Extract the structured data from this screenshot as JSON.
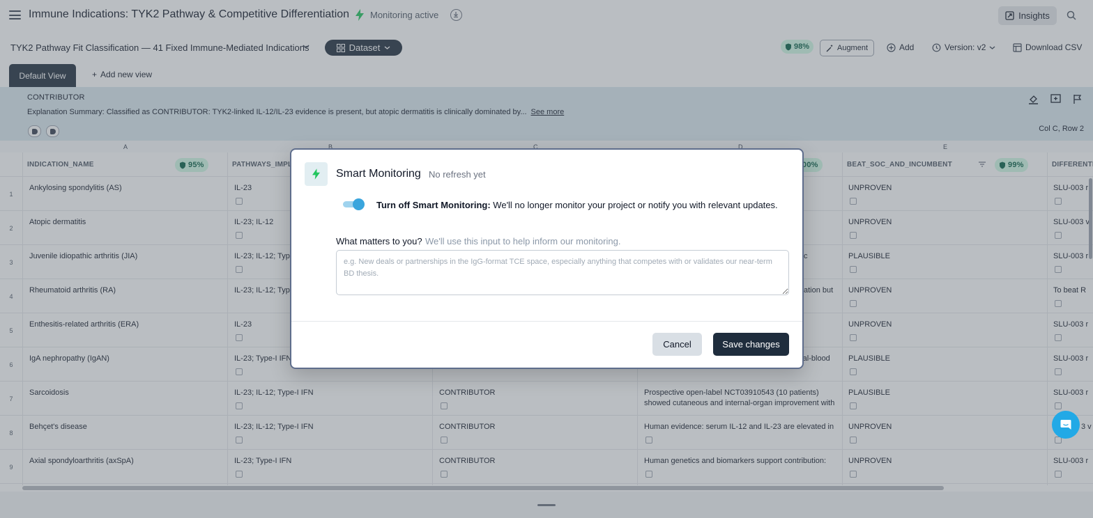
{
  "header": {
    "title": "Immune Indications: TYK2 Pathway & Competitive Differentiation",
    "monitoring_status": "Monitoring active",
    "insights_label": "Insights"
  },
  "toolbar": {
    "project_title": "TYK2 Pathway Fit Classification — 41 Fixed Immune-Mediated Indications",
    "dataset_label": "Dataset",
    "quality_badge": "98%",
    "augment_label": "Augment",
    "add_label": "Add",
    "version_label": "Version: v2",
    "download_label": "Download CSV"
  },
  "tabs": {
    "default_view": "Default View",
    "add_view": "Add new view"
  },
  "explanation": {
    "label": "CONTRIBUTOR",
    "text": "Explanation Summary: Classified as CONTRIBUTOR: TYK2-linked IL-12/IL-23 evidence is present, but atopic dermatitis is clinically dominated by...",
    "see_more": "See more",
    "cell_position": "Col C, Row 2"
  },
  "grid": {
    "column_letters": [
      "A",
      "B",
      "C",
      "D",
      "E"
    ],
    "headers": {
      "a": "INDICATION_NAME",
      "a_badge": "95%",
      "b": "PATHWAYS_IMPL",
      "d_badge": "00%",
      "e": "BEAT_SOC_AND_INCUMBENT",
      "e_badge": "99%",
      "f": "DIFFERENTIA"
    },
    "rows": [
      {
        "num": "1",
        "a": "Ankylosing spondylitis (AS)",
        "b": "IL-23",
        "c": "",
        "d": "",
        "e": "UNPROVEN",
        "f": "SLU-003 r"
      },
      {
        "num": "2",
        "a": "Atopic dermatitis",
        "b": "IL-23; IL-12",
        "c": "",
        "d": "",
        "e": "UNPROVEN",
        "f": "SLU-003 v"
      },
      {
        "num": "3",
        "a": "Juvenile idiopathic arthritis (JIA)",
        "b": "IL-23; IL-12; Typ",
        "c": "",
        "d": "c",
        "e": "PLAUSIBLE",
        "f": "SLU-003 r"
      },
      {
        "num": "4",
        "a": "Rheumatoid arthritis (RA)",
        "b": "IL-23; IL-12; Typ",
        "c": "",
        "d": "ation but",
        "e": "UNPROVEN",
        "f": "To beat R"
      },
      {
        "num": "5",
        "a": "Enthesitis-related arthritis (ERA)",
        "b": "IL-23",
        "c": "",
        "d": "",
        "e": "UNPROVEN",
        "f": "SLU-003 r"
      },
      {
        "num": "6",
        "a": "IgA nephropathy (IgAN)",
        "b": "IL-23; Type-I IFN",
        "c": "",
        "d": "ral-blood",
        "e": "PLAUSIBLE",
        "f": "SLU-003 r"
      },
      {
        "num": "7",
        "a": "Sarcoidosis",
        "b": "IL-23; IL-12; Type-I IFN",
        "c": "CONTRIBUTOR",
        "d": "Prospective open-label NCT03910543 (10 patients)",
        "d2": "showed cutaneous and internal-organ improvement with",
        "e": "PLAUSIBLE",
        "f": "SLU-003 r"
      },
      {
        "num": "8",
        "a": "Behçet's disease",
        "b": "IL-23; IL-12; Type-I IFN",
        "c": "CONTRIBUTOR",
        "d": "Human evidence: serum IL-12 and IL-23 are elevated in",
        "e": "UNPROVEN",
        "f": "3 v"
      },
      {
        "num": "9",
        "a": "Axial spondyloarthritis (axSpA)",
        "b": "IL-23; Type-I IFN",
        "c": "CONTRIBUTOR",
        "d": "Human genetics and biomarkers support contribution:",
        "e": "UNPROVEN",
        "f": "SLU-003 r"
      }
    ]
  },
  "modal": {
    "title": "Smart Monitoring",
    "subtitle": "No refresh yet",
    "toggle_bold": "Turn off Smart Monitoring:",
    "toggle_text": " We'll no longer monitor your project or notify you with relevant updates.",
    "question_label": "What matters to you?",
    "question_hint": "We'll use this input to help inform our monitoring.",
    "placeholder": "e.g. New deals or partnerships in the IgG-format TCE space, especially anything that competes with or validates our near-term BD thesis.",
    "cancel_label": "Cancel",
    "save_label": "Save changes"
  },
  "colors": {
    "navy": "#1f2d3d",
    "accent_blue": "#3aa5dd",
    "monitor_green": "#22c55e",
    "badge_green": "#d1fae5"
  },
  "icons": [
    "menu-icon",
    "bolt-icon",
    "download-icon",
    "insights-icon",
    "search-icon",
    "chevron-down-icon",
    "grid-icon",
    "shield-icon",
    "wand-icon",
    "plus-circle-icon",
    "history-icon",
    "csv-icon",
    "fill-icon",
    "add-box-icon",
    "flag-icon",
    "filter-icon",
    "chat-icon"
  ]
}
